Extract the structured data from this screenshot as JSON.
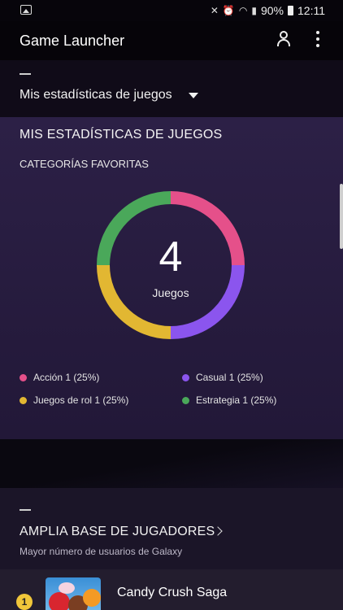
{
  "status_bar": {
    "battery": "90%",
    "time": "12:11"
  },
  "app_bar": {
    "title": "Game Launcher",
    "icons": [
      "user-icon",
      "more-vert-icon"
    ]
  },
  "section_selector": {
    "label": "Mis estadísticas de juegos"
  },
  "stats_card": {
    "title": "MIS ESTADÍSTICAS DE JUEGOS",
    "subtitle": "CATEGORÍAS FAVORITAS",
    "total_count": "4",
    "total_label": "Juegos",
    "categories": [
      {
        "label": "Acción 1 (25%)",
        "value": 25,
        "color": "#e5508a"
      },
      {
        "label": "Casual 1 (25%)",
        "value": 25,
        "color": "#8b55ee"
      },
      {
        "label": "Juegos de rol 1 (25%)",
        "value": 25,
        "color": "#e2b732"
      },
      {
        "label": "Estrategia 1 (25%)",
        "value": 25,
        "color": "#4aa85a"
      }
    ]
  },
  "players_section": {
    "title": "AMPLIA BASE DE JUGADORES",
    "subtitle": "Mayor número de usuarios de Galaxy"
  },
  "game_list": [
    {
      "rank": "1",
      "name": "Candy Crush Saga"
    }
  ]
}
